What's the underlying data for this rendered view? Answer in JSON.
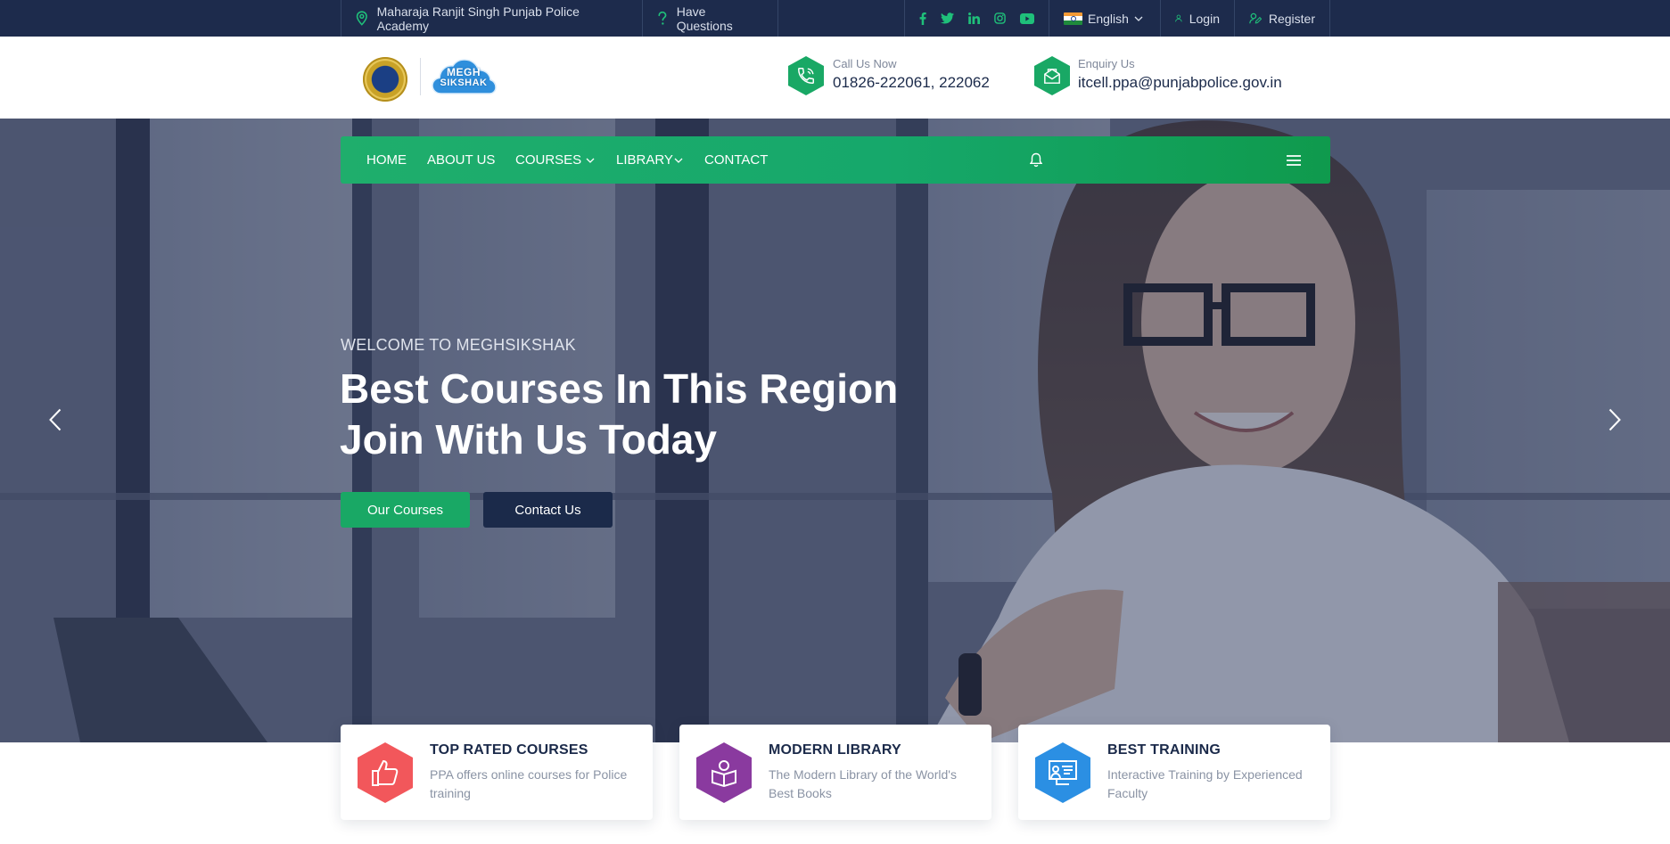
{
  "topbar": {
    "address": "Maharaja Ranjit Singh Punjab Police Academy",
    "questions": "Have Questions",
    "social": [
      "facebook-icon",
      "twitter-icon",
      "linkedin-icon",
      "instagram-icon",
      "youtube-icon"
    ],
    "language": "English",
    "login": "Login",
    "register": "Register"
  },
  "header": {
    "logo_text_line1": "MEGH",
    "logo_text_line2": "SIKSHAK",
    "call_label": "Call Us Now",
    "call_value": "01826-222061, 222062",
    "enquiry_label": "Enquiry Us",
    "enquiry_value": "itcell.ppa@punjabpolice.gov.in"
  },
  "nav": {
    "items": [
      "HOME",
      "ABOUT US",
      "COURSES",
      "LIBRARY",
      "CONTACT"
    ]
  },
  "hero": {
    "eyebrow": "WELCOME TO MEGHSIKSHAK",
    "headline_line1": "Best Courses In This Region",
    "headline_line2": "Join With Us Today",
    "primary_button": "Our Courses",
    "secondary_button": "Contact Us"
  },
  "features": [
    {
      "title": "TOP RATED COURSES",
      "description": "PPA offers online courses for Police training",
      "icon": "thumbs-up-icon",
      "color": "#f2575b"
    },
    {
      "title": "MODERN LIBRARY",
      "description": "The Modern Library of the World's Best Books",
      "icon": "reading-book-icon",
      "color": "#8a3a9f"
    },
    {
      "title": "BEST TRAINING",
      "description": "Interactive Training by Experienced Faculty",
      "icon": "presentation-board-icon",
      "color": "#2b8fe3"
    }
  ],
  "colors": {
    "topbar": "#1d2b4c",
    "accent_green": "#19a865",
    "navy": "#1b2a4a"
  }
}
